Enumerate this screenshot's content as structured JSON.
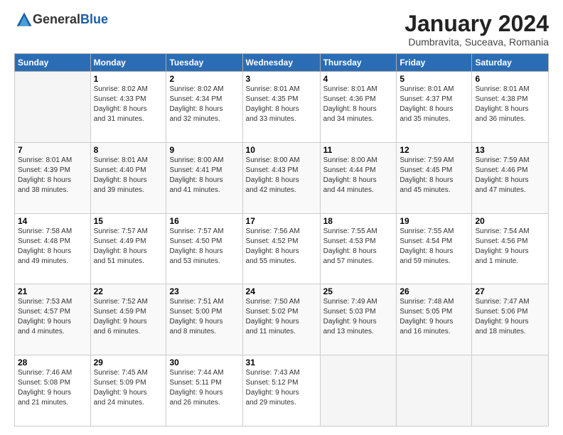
{
  "header": {
    "logo_general": "General",
    "logo_blue": "Blue",
    "month_title": "January 2024",
    "location": "Dumbravita, Suceava, Romania"
  },
  "days_of_week": [
    "Sunday",
    "Monday",
    "Tuesday",
    "Wednesday",
    "Thursday",
    "Friday",
    "Saturday"
  ],
  "weeks": [
    [
      {
        "day": "",
        "info": ""
      },
      {
        "day": "1",
        "info": "Sunrise: 8:02 AM\nSunset: 4:33 PM\nDaylight: 8 hours\nand 31 minutes."
      },
      {
        "day": "2",
        "info": "Sunrise: 8:02 AM\nSunset: 4:34 PM\nDaylight: 8 hours\nand 32 minutes."
      },
      {
        "day": "3",
        "info": "Sunrise: 8:01 AM\nSunset: 4:35 PM\nDaylight: 8 hours\nand 33 minutes."
      },
      {
        "day": "4",
        "info": "Sunrise: 8:01 AM\nSunset: 4:36 PM\nDaylight: 8 hours\nand 34 minutes."
      },
      {
        "day": "5",
        "info": "Sunrise: 8:01 AM\nSunset: 4:37 PM\nDaylight: 8 hours\nand 35 minutes."
      },
      {
        "day": "6",
        "info": "Sunrise: 8:01 AM\nSunset: 4:38 PM\nDaylight: 8 hours\nand 36 minutes."
      }
    ],
    [
      {
        "day": "7",
        "info": "Sunrise: 8:01 AM\nSunset: 4:39 PM\nDaylight: 8 hours\nand 38 minutes."
      },
      {
        "day": "8",
        "info": "Sunrise: 8:01 AM\nSunset: 4:40 PM\nDaylight: 8 hours\nand 39 minutes."
      },
      {
        "day": "9",
        "info": "Sunrise: 8:00 AM\nSunset: 4:41 PM\nDaylight: 8 hours\nand 41 minutes."
      },
      {
        "day": "10",
        "info": "Sunrise: 8:00 AM\nSunset: 4:43 PM\nDaylight: 8 hours\nand 42 minutes."
      },
      {
        "day": "11",
        "info": "Sunrise: 8:00 AM\nSunset: 4:44 PM\nDaylight: 8 hours\nand 44 minutes."
      },
      {
        "day": "12",
        "info": "Sunrise: 7:59 AM\nSunset: 4:45 PM\nDaylight: 8 hours\nand 45 minutes."
      },
      {
        "day": "13",
        "info": "Sunrise: 7:59 AM\nSunset: 4:46 PM\nDaylight: 8 hours\nand 47 minutes."
      }
    ],
    [
      {
        "day": "14",
        "info": "Sunrise: 7:58 AM\nSunset: 4:48 PM\nDaylight: 8 hours\nand 49 minutes."
      },
      {
        "day": "15",
        "info": "Sunrise: 7:57 AM\nSunset: 4:49 PM\nDaylight: 8 hours\nand 51 minutes."
      },
      {
        "day": "16",
        "info": "Sunrise: 7:57 AM\nSunset: 4:50 PM\nDaylight: 8 hours\nand 53 minutes."
      },
      {
        "day": "17",
        "info": "Sunrise: 7:56 AM\nSunset: 4:52 PM\nDaylight: 8 hours\nand 55 minutes."
      },
      {
        "day": "18",
        "info": "Sunrise: 7:55 AM\nSunset: 4:53 PM\nDaylight: 8 hours\nand 57 minutes."
      },
      {
        "day": "19",
        "info": "Sunrise: 7:55 AM\nSunset: 4:54 PM\nDaylight: 8 hours\nand 59 minutes."
      },
      {
        "day": "20",
        "info": "Sunrise: 7:54 AM\nSunset: 4:56 PM\nDaylight: 9 hours\nand 1 minute."
      }
    ],
    [
      {
        "day": "21",
        "info": "Sunrise: 7:53 AM\nSunset: 4:57 PM\nDaylight: 9 hours\nand 4 minutes."
      },
      {
        "day": "22",
        "info": "Sunrise: 7:52 AM\nSunset: 4:59 PM\nDaylight: 9 hours\nand 6 minutes."
      },
      {
        "day": "23",
        "info": "Sunrise: 7:51 AM\nSunset: 5:00 PM\nDaylight: 9 hours\nand 8 minutes."
      },
      {
        "day": "24",
        "info": "Sunrise: 7:50 AM\nSunset: 5:02 PM\nDaylight: 9 hours\nand 11 minutes."
      },
      {
        "day": "25",
        "info": "Sunrise: 7:49 AM\nSunset: 5:03 PM\nDaylight: 9 hours\nand 13 minutes."
      },
      {
        "day": "26",
        "info": "Sunrise: 7:48 AM\nSunset: 5:05 PM\nDaylight: 9 hours\nand 16 minutes."
      },
      {
        "day": "27",
        "info": "Sunrise: 7:47 AM\nSunset: 5:06 PM\nDaylight: 9 hours\nand 18 minutes."
      }
    ],
    [
      {
        "day": "28",
        "info": "Sunrise: 7:46 AM\nSunset: 5:08 PM\nDaylight: 9 hours\nand 21 minutes."
      },
      {
        "day": "29",
        "info": "Sunrise: 7:45 AM\nSunset: 5:09 PM\nDaylight: 9 hours\nand 24 minutes."
      },
      {
        "day": "30",
        "info": "Sunrise: 7:44 AM\nSunset: 5:11 PM\nDaylight: 9 hours\nand 26 minutes."
      },
      {
        "day": "31",
        "info": "Sunrise: 7:43 AM\nSunset: 5:12 PM\nDaylight: 9 hours\nand 29 minutes."
      },
      {
        "day": "",
        "info": ""
      },
      {
        "day": "",
        "info": ""
      },
      {
        "day": "",
        "info": ""
      }
    ]
  ]
}
